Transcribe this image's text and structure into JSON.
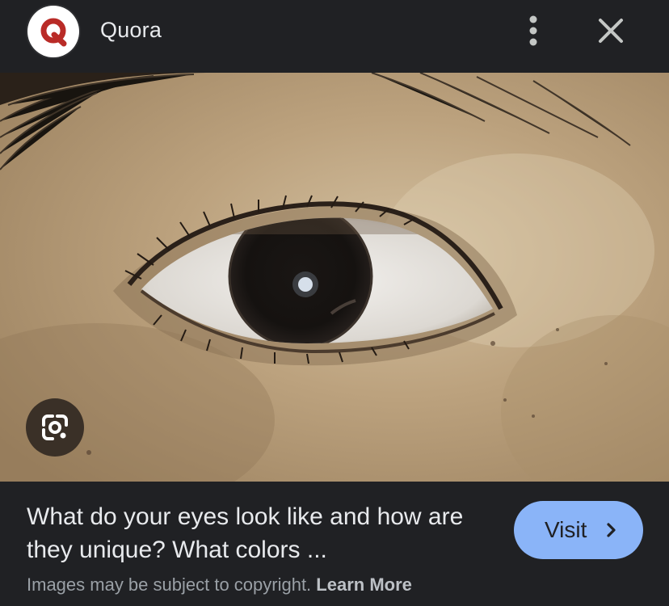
{
  "header": {
    "site_name": "Quora",
    "logo_icon": "quora-logo",
    "more_icon": "more-vertical-icon",
    "close_icon": "close-icon"
  },
  "image": {
    "subject": "eye-photo",
    "lens_icon": "google-lens-icon"
  },
  "result": {
    "title": "What do your eyes look like and how are they unique? What colors ...",
    "visit_label": "Visit",
    "copyright_text": "Images may be subject to copyright.",
    "learn_more_label": "Learn More"
  },
  "colors": {
    "background": "#202124",
    "accent": "#8ab4f8",
    "quora_red": "#b92b27"
  }
}
